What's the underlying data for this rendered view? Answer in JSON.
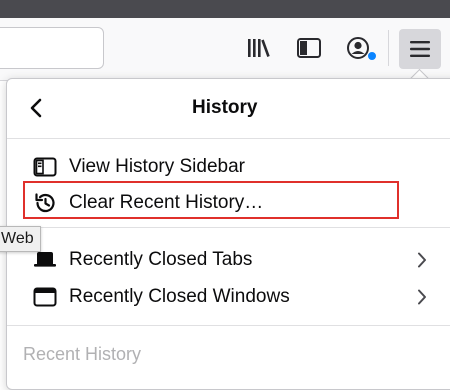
{
  "panel": {
    "title": "History",
    "items": [
      {
        "label": "View History Sidebar",
        "icon": "sidebar-icon"
      },
      {
        "label": "Clear Recent History…",
        "icon": "history-clock-icon"
      },
      {
        "label": "Recently Closed Tabs",
        "icon": "closed-tab-icon"
      },
      {
        "label": "Recently Closed Windows",
        "icon": "window-icon"
      }
    ],
    "section_label": "Recent History"
  },
  "tooltip": "Web",
  "colors": {
    "highlight": "#e0302b",
    "notification_dot": "#0a84ff",
    "titlebar": "#4a4a4f"
  },
  "toolbar_icons": [
    "library-icon",
    "sidebars-icon",
    "account-icon",
    "hamburger-menu-icon"
  ]
}
